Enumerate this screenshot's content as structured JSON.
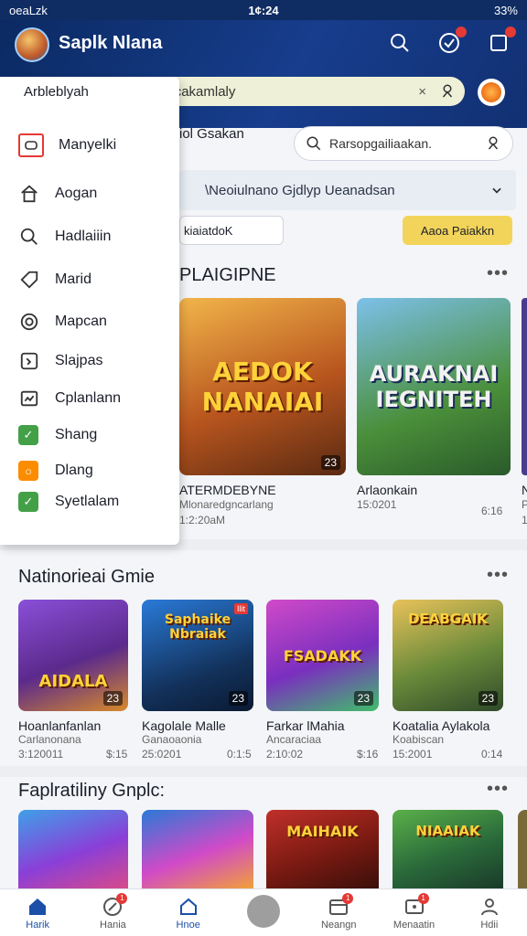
{
  "status": {
    "left": "oeaLzk",
    "time": "1¢:24",
    "battery": "33%"
  },
  "app": {
    "title": "Saplk Nlana"
  },
  "drawer": {
    "title": "Arbleblyah",
    "search_placeholder": "Bancakamlaly",
    "items": [
      {
        "label": "Manyelki",
        "icon": "calendar-icon",
        "color": "#e53935"
      },
      {
        "label": "Aogan",
        "icon": "home-icon",
        "color": ""
      },
      {
        "label": "Hadlaiiin",
        "icon": "search-icon",
        "color": ""
      },
      {
        "label": "Marid",
        "icon": "tag-icon",
        "color": ""
      },
      {
        "label": "Mapcan",
        "icon": "circle-icon",
        "color": ""
      },
      {
        "label": "Slajpas",
        "icon": "note-icon",
        "color": ""
      },
      {
        "label": "Cplanlann",
        "icon": "chart-icon",
        "color": ""
      },
      {
        "label": "Shang",
        "icon": "check-icon",
        "color": "#43a047"
      },
      {
        "label": "Dlang",
        "icon": "badge-icon",
        "color": "#fb8c00"
      },
      {
        "label": "Syetlalam",
        "icon": "check-icon",
        "color": "#43a047"
      }
    ]
  },
  "main": {
    "row_label": "iol Gsakan",
    "search_placeholder": "Rarsopgailiaakan.",
    "notice": "\\Neoiulnano Gjdlyp Ueanadsan",
    "chip": "kiaiatdoK",
    "action_button": "Aaoa Paiakkn",
    "section1": {
      "title": "PLAIGIPNE",
      "cards": [
        {
          "art": "AEDOK NANAIAI",
          "num": "23",
          "name": "ATERMDEBYNE",
          "sub": "Mlonaredgncarlang",
          "time": "1:2:20aM",
          "extra": ""
        },
        {
          "art": "AURAKNAI IEGNITEH",
          "num": "",
          "name": "Arlaonkain",
          "sub": "15:0201",
          "time": "",
          "extra": "6:16"
        },
        {
          "art": "",
          "num": "",
          "name": "N",
          "sub": "P",
          "time": "1",
          "extra": ""
        }
      ]
    },
    "section2": {
      "title": "Natinorieai Gmie",
      "cards": [
        {
          "art": "AIDALA",
          "num": "23",
          "tag": "",
          "name": "Hoanlanfanlan",
          "sub": "Carlanonana",
          "time": "3:120011",
          "extra": "$:15"
        },
        {
          "art": "Saphaike Nbraiak",
          "num": "23",
          "tag": "Ilit",
          "name": "Kagolale Malle",
          "sub": "Ganaoaonia",
          "time": "25:0201",
          "extra": "0:1:5"
        },
        {
          "art": "FSADAKK",
          "num": "23",
          "tag": "",
          "name": "Farkar lMahia",
          "sub": "Ancaraciaa",
          "time": "2:10:02",
          "extra": "$:16"
        },
        {
          "art": "DEABGAIK",
          "num": "23",
          "tag": "",
          "name": "Koatalia Aylakola",
          "sub": "Koabiscan",
          "time": "15:2001",
          "extra": "0:14"
        }
      ]
    },
    "section3": {
      "title": "Faplratiliny Gnplc:",
      "cards": [
        {
          "art": "",
          "tag": ""
        },
        {
          "art": "",
          "tag": ""
        },
        {
          "art": "MAIHAIK",
          "tag": ""
        },
        {
          "art": "NIAAIAK",
          "tag": ""
        }
      ]
    }
  },
  "bottom_nav": [
    {
      "label": "Harik",
      "icon": "home-icon",
      "badge": ""
    },
    {
      "label": "Hania",
      "icon": "compass-icon",
      "badge": "1"
    },
    {
      "label": "Hnoe",
      "icon": "house-icon",
      "badge": ""
    },
    {
      "label": "",
      "icon": "center-fab-icon",
      "badge": ""
    },
    {
      "label": "Neangn",
      "icon": "calendar-icon",
      "badge": "1"
    },
    {
      "label": "Menaatin",
      "icon": "message-icon",
      "badge": "1"
    },
    {
      "label": "Hdii",
      "icon": "user-icon",
      "badge": ""
    }
  ]
}
